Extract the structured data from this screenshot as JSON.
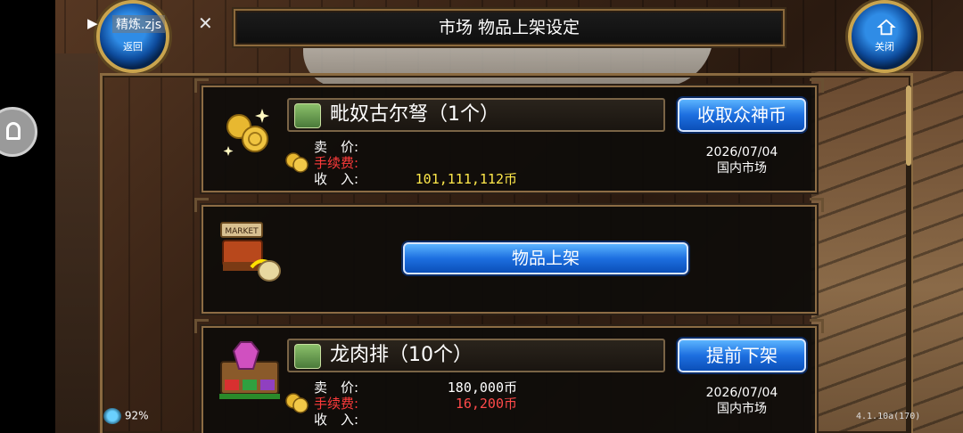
{
  "title_bar": {
    "title": "市场  物品上架设定"
  },
  "nav": {
    "back_label": "返回",
    "close_label": "关闭"
  },
  "overlay": {
    "file_name": "精炼.zjs",
    "play_glyph": "▶",
    "close_glyph": "✕"
  },
  "listings": [
    {
      "name": "毗奴古尔弩（1个）",
      "action_label": "收取众神币",
      "sell_price_label": "卖　价:",
      "sell_price_value": "",
      "fee_label": "手续费:",
      "fee_value": "",
      "income_label": "收　入:",
      "income_value": "101,111,112币",
      "date": "2026/07/04",
      "market": "国内市场"
    },
    {
      "name": "龙肉排（10个）",
      "action_label": "提前下架",
      "sell_price_label": "卖　价:",
      "sell_price_value": "180,000币",
      "fee_label": "手续费:",
      "fee_value": "16,200币",
      "income_label": "收　入:",
      "income_value": "",
      "date": "2026/07/04",
      "market": "国内市场"
    }
  ],
  "new_listing": {
    "button_label": "物品上架",
    "market_sign": "MARKET"
  },
  "status": {
    "battery": "92%",
    "version": "4.1.10a(170)"
  },
  "colors": {
    "accent_blue": "#1d6fe0",
    "fee_red": "#ff3b3b",
    "income_yellow": "#ffe84a",
    "frame_gold": "#8c6c44"
  },
  "icons": [
    "back-orb-icon",
    "home-icon",
    "coin-stack-icon",
    "crossbow-icon",
    "market-stall-icon",
    "money-bag-icon",
    "meat-pot-icon",
    "battery-icon"
  ]
}
